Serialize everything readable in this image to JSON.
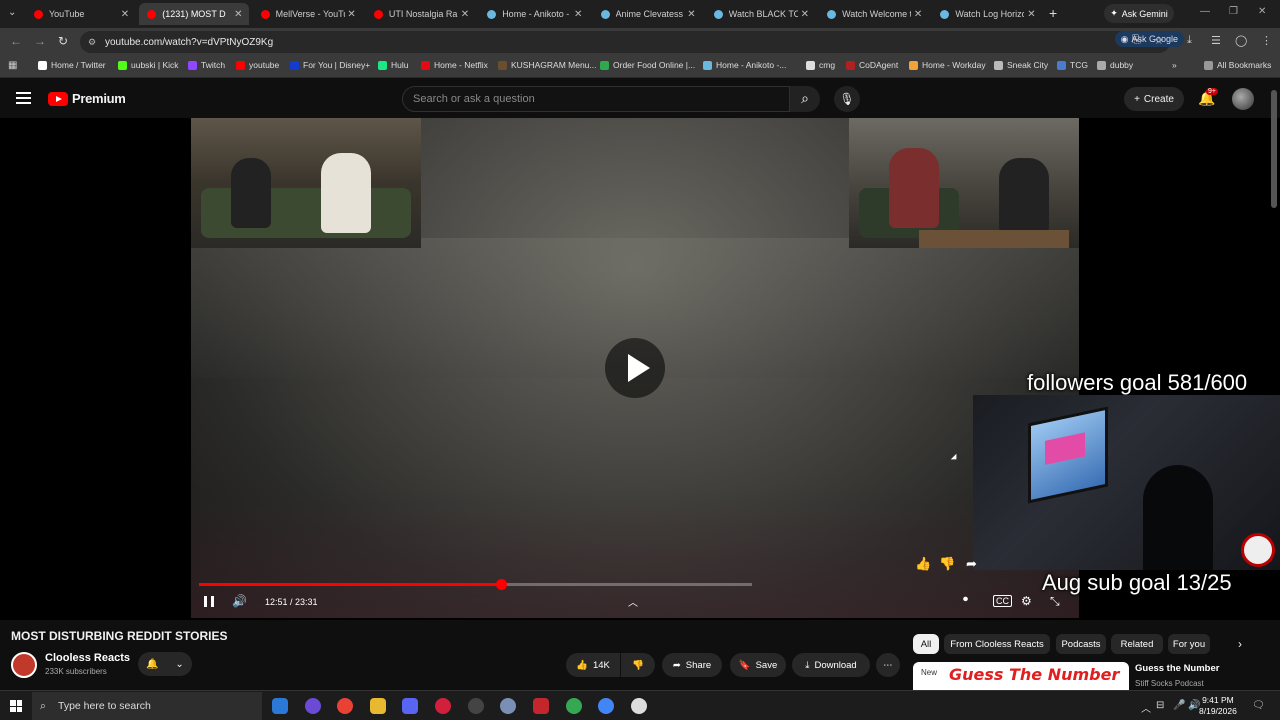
{
  "browser": {
    "tabs": [
      {
        "label": "YouTube",
        "active": false,
        "icon": "youtube-icon"
      },
      {
        "label": "(1231) MOST D",
        "active": true,
        "icon": "youtube-icon"
      },
      {
        "label": "MellVerse - YouTu",
        "active": false,
        "icon": "youtube-icon"
      },
      {
        "label": "UTI Nostalgia Ran",
        "active": false,
        "icon": "youtube-icon"
      },
      {
        "label": "Home - Anikoto -",
        "active": false,
        "icon": "globe-icon"
      },
      {
        "label": "Anime Clevatess S",
        "active": false,
        "icon": "globe-icon"
      },
      {
        "label": "Watch BLACK TOR",
        "active": false,
        "icon": "globe-icon"
      },
      {
        "label": "Watch Welcome to",
        "active": false,
        "icon": "globe-icon"
      },
      {
        "label": "Watch Log Horizo",
        "active": false,
        "icon": "globe-icon"
      }
    ],
    "gemini_label": "Ask Gemini",
    "url": "youtube.com/watch?v=dVPtNyOZ9Kg",
    "ask_google_label": "Ask Google",
    "bookmarks": [
      "Home / Twitter",
      "uubski | Kick",
      "Twitch",
      "youtube",
      "For You | Disney+",
      "Hulu",
      "Home - Netflix",
      "KUSHAGRAM Menu...",
      "Order Food Online |...",
      "Home - Anikoto -...",
      "cmg",
      "CoDAgent",
      "Home - Workday",
      "Sneak City",
      "TCG",
      "dubby"
    ],
    "all_bookmarks_label": "All Bookmarks"
  },
  "youtube": {
    "logo_text": "Premium",
    "search_placeholder": "Search or ask a question",
    "create_label": "Create",
    "notif_count": "9+"
  },
  "player": {
    "overlay_followers": "followers goal 581/600",
    "overlay_subs": "Aug sub goal 13/25",
    "time_current": "12:51",
    "time_total": "23:31",
    "time_display": "12:51 / 23:31",
    "progress": 0.546,
    "accent": "#ff0000"
  },
  "video": {
    "title": "MOST DISTURBING REDDIT STORIES",
    "channel": "Clooless Reacts",
    "subscribers": "233K subscribers",
    "likes": "14K",
    "share_label": "Share",
    "save_label": "Save",
    "download_label": "Download"
  },
  "recommendations": {
    "chips": [
      "All",
      "From Clooless Reacts",
      "Podcasts",
      "Related",
      "For you"
    ],
    "item": {
      "thumb_badge": "New",
      "thumb_text": "Guess The Number",
      "title": "Guess the Number",
      "channel": "Stiff Socks Podcast"
    }
  },
  "taskbar": {
    "search_placeholder": "Type here to search",
    "time": "9:41 PM",
    "date": "8/19/2026"
  }
}
